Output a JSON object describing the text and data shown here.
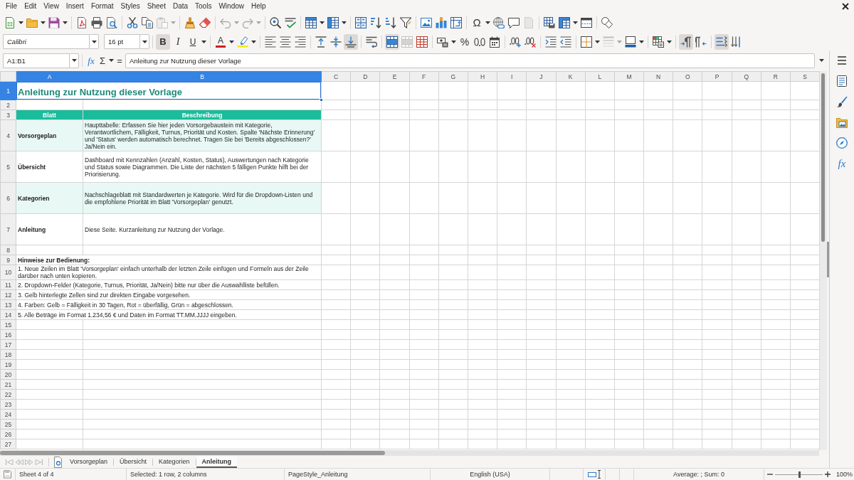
{
  "menu": [
    "File",
    "Edit",
    "View",
    "Insert",
    "Format",
    "Styles",
    "Sheet",
    "Data",
    "Tools",
    "Window",
    "Help"
  ],
  "standard_toolbar": [
    [
      {
        "kind": "new",
        "disabled": false
      },
      {
        "kind": "open",
        "disabled": false
      },
      {
        "kind": "save",
        "disabled": false
      }
    ],
    [
      {
        "kind": "pdf",
        "disabled": false
      },
      {
        "kind": "print",
        "disabled": false
      },
      {
        "kind": "preview",
        "disabled": false
      }
    ],
    [
      {
        "kind": "cut",
        "disabled": false
      },
      {
        "kind": "copy",
        "disabled": false
      },
      {
        "kind": "paste",
        "disabled": true
      }
    ],
    [
      {
        "kind": "clone",
        "disabled": false
      },
      {
        "kind": "clear",
        "disabled": false
      }
    ],
    [
      {
        "kind": "undo",
        "disabled": true
      },
      {
        "kind": "redo",
        "disabled": true
      }
    ],
    [
      {
        "kind": "find",
        "disabled": false
      },
      {
        "kind": "spelling",
        "disabled": false
      }
    ],
    [
      {
        "kind": "rows",
        "disabled": false
      },
      {
        "kind": "columns",
        "disabled": false
      }
    ],
    [
      {
        "kind": "sort",
        "disabled": false
      },
      {
        "kind": "ascending",
        "disabled": false
      },
      {
        "kind": "descending",
        "disabled": false
      },
      {
        "kind": "autofilter",
        "disabled": false
      }
    ],
    [
      {
        "kind": "image",
        "disabled": false
      },
      {
        "kind": "chart",
        "disabled": false
      },
      {
        "kind": "pivot",
        "disabled": false
      }
    ],
    [
      {
        "kind": "special",
        "label": "Ω",
        "disabled": false
      },
      {
        "kind": "hyperlink",
        "disabled": false
      },
      {
        "kind": "comment",
        "disabled": false
      },
      {
        "kind": "headers",
        "disabled": true
      }
    ],
    [
      {
        "kind": "printarea",
        "disabled": false
      },
      {
        "kind": "freeze",
        "disabled": false
      },
      {
        "kind": "split",
        "disabled": false
      }
    ],
    [
      {
        "kind": "shapes",
        "disabled": false
      }
    ]
  ],
  "formatting_toolbar": {
    "font_name": "Calibri",
    "font_size": "16 pt",
    "groups": [
      [
        {
          "kind": "bold",
          "label": "B",
          "pressed": true,
          "disabled": false
        },
        {
          "kind": "italic",
          "label": "I",
          "pressed": false,
          "disabled": false
        },
        {
          "kind": "underline",
          "label": "U",
          "pressed": false,
          "disabled": false
        }
      ],
      [
        {
          "kind": "fontcolor",
          "label": "A",
          "pressed": false,
          "disabled": false
        },
        {
          "kind": "highlight",
          "pressed": false,
          "disabled": false
        }
      ],
      [
        {
          "kind": "left",
          "pressed": false,
          "disabled": false
        },
        {
          "kind": "center",
          "pressed": false,
          "disabled": false
        },
        {
          "kind": "right",
          "pressed": false,
          "disabled": false
        }
      ],
      [
        {
          "kind": "top",
          "pressed": false,
          "disabled": false
        },
        {
          "kind": "middle",
          "pressed": false,
          "disabled": false
        },
        {
          "kind": "bottom",
          "pressed": true,
          "disabled": false
        }
      ],
      [
        {
          "kind": "wrap",
          "pressed": false,
          "disabled": false
        }
      ],
      [
        {
          "kind": "mergecenter",
          "pressed": true,
          "disabled": false
        },
        {
          "kind": "merge",
          "pressed": false,
          "disabled": true
        },
        {
          "kind": "unmerge",
          "pressed": false,
          "disabled": false
        }
      ],
      [
        {
          "kind": "currency",
          "pressed": false,
          "disabled": false
        },
        {
          "kind": "percent",
          "label": "%",
          "pressed": false,
          "disabled": false
        },
        {
          "kind": "standard",
          "pressed": false,
          "disabled": false
        },
        {
          "kind": "date",
          "pressed": false,
          "disabled": false
        }
      ],
      [
        {
          "kind": "adddecimal",
          "pressed": false,
          "disabled": false
        },
        {
          "kind": "deldecimal",
          "pressed": false,
          "disabled": false
        }
      ],
      [
        {
          "kind": "indent",
          "pressed": false,
          "disabled": false
        },
        {
          "kind": "outdent",
          "pressed": false,
          "disabled": false
        }
      ],
      [
        {
          "kind": "borders",
          "pressed": false,
          "disabled": false
        },
        {
          "kind": "borderstyle",
          "pressed": false,
          "disabled": true
        },
        {
          "kind": "bordercolor",
          "pressed": false,
          "disabled": false
        }
      ],
      [
        {
          "kind": "conditional",
          "pressed": false,
          "disabled": false
        }
      ],
      [
        {
          "kind": "ltr",
          "pressed": true,
          "disabled": false
        },
        {
          "kind": "rtl",
          "pressed": false,
          "disabled": false
        }
      ],
      [
        {
          "kind": "textltr",
          "pressed": true,
          "disabled": false
        },
        {
          "kind": "texttb",
          "pressed": false,
          "disabled": false
        }
      ]
    ]
  },
  "formula_bar": {
    "name_box": "A1:B1",
    "wizard": "fx",
    "sum": "Σ",
    "equals": "=",
    "content": "Anleitung zur Nutzung dieser Vorlage"
  },
  "sheet": {
    "columns": [
      {
        "label": "A",
        "selected": true
      },
      {
        "label": "B",
        "selected": true
      },
      {
        "label": "C",
        "selected": false
      },
      {
        "label": "D",
        "selected": false
      },
      {
        "label": "E",
        "selected": false
      },
      {
        "label": "F",
        "selected": false
      },
      {
        "label": "G",
        "selected": false
      },
      {
        "label": "H",
        "selected": false
      },
      {
        "label": "I",
        "selected": false
      },
      {
        "label": "J",
        "selected": false
      },
      {
        "label": "K",
        "selected": false
      },
      {
        "label": "L",
        "selected": false
      },
      {
        "label": "M",
        "selected": false
      },
      {
        "label": "N",
        "selected": false
      },
      {
        "label": "O",
        "selected": false
      },
      {
        "label": "P",
        "selected": false
      },
      {
        "label": "Q",
        "selected": false
      },
      {
        "label": "R",
        "selected": false
      },
      {
        "label": "S",
        "selected": false
      }
    ],
    "rows": [
      {
        "label": "1",
        "selected": true,
        "kind": "title",
        "cells": [
          "Anleitung zur Nutzung dieser Vorlage"
        ]
      },
      {
        "label": "2",
        "selected": false,
        "kind": "blank"
      },
      {
        "label": "3",
        "selected": false,
        "kind": "header",
        "cells": [
          "Blatt",
          "Beschreibung"
        ]
      },
      {
        "label": "4",
        "selected": false,
        "kind": "entry",
        "shaded": true,
        "cells": [
          "Vorsorgeplan",
          "Haupttabelle: Erfassen Sie hier jeden Vorsorgebaustein mit Kategorie, Verantwortlichem, Fälligkeit, Turnus, Priorität und Kosten. Spalte 'Nächste Erinnerung' und 'Status' werden automatisch berechnet. Tragen Sie bei 'Bereits abgeschlossen?' Ja/Nein ein."
        ]
      },
      {
        "label": "5",
        "selected": false,
        "kind": "entry",
        "shaded": false,
        "cells": [
          "Übersicht",
          "Dashboard mit Kennzahlen (Anzahl, Kosten, Status), Auswertungen nach Kategorie und Status sowie Diagrammen. Die Liste der nächsten 5 fälligen Punkte hilft bei der Priorisierung."
        ]
      },
      {
        "label": "6",
        "selected": false,
        "kind": "entry",
        "shaded": true,
        "cells": [
          "Kategorien",
          "Nachschlageblatt mit Standardwerten je Kategorie. Wird für die Dropdown-Listen und die empfohlene Priorität im Blatt 'Vorsorgeplan' genutzt."
        ]
      },
      {
        "label": "7",
        "selected": false,
        "kind": "entry",
        "shaded": false,
        "cells": [
          "Anleitung",
          "Diese Seite. Kurzanleitung zur Nutzung der Vorlage."
        ]
      },
      {
        "label": "8",
        "selected": false,
        "kind": "blank"
      },
      {
        "label": "9",
        "selected": false,
        "kind": "heading",
        "cells": [
          "Hinweise zur Bedienung:"
        ]
      },
      {
        "label": "10",
        "selected": false,
        "kind": "note",
        "cells": [
          "1. Neue Zeilen im Blatt 'Vorsorgeplan' einfach unterhalb der letzten Zeile einfügen und Formeln aus der Zeile darüber nach unten kopieren."
        ]
      },
      {
        "label": "11",
        "selected": false,
        "kind": "note",
        "cells": [
          "2. Dropdown-Felder (Kategorie, Turnus, Priorität, Ja/Nein) bitte nur über die Auswahlliste befüllen."
        ]
      },
      {
        "label": "12",
        "selected": false,
        "kind": "note",
        "cells": [
          "3. Gelb hinterlegte Zellen sind zur direkten Eingabe vorgesehen."
        ]
      },
      {
        "label": "13",
        "selected": false,
        "kind": "note",
        "cells": [
          "4. Farben: Gelb = Fälligkeit in 30 Tagen, Rot = überfällig, Grün = abgeschlossen."
        ]
      },
      {
        "label": "14",
        "selected": false,
        "kind": "note",
        "cells": [
          "5. Alle Beträge im Format 1.234,56 € und Daten im Format TT.MM.JJJJ eingeben."
        ]
      },
      {
        "label": "15",
        "selected": false,
        "kind": "blank"
      },
      {
        "label": "16",
        "selected": false,
        "kind": "blank"
      },
      {
        "label": "17",
        "selected": false,
        "kind": "blank"
      },
      {
        "label": "18",
        "selected": false,
        "kind": "blank"
      },
      {
        "label": "19",
        "selected": false,
        "kind": "blank"
      },
      {
        "label": "20",
        "selected": false,
        "kind": "blank"
      },
      {
        "label": "21",
        "selected": false,
        "kind": "blank"
      },
      {
        "label": "22",
        "selected": false,
        "kind": "blank"
      },
      {
        "label": "23",
        "selected": false,
        "kind": "blank"
      },
      {
        "label": "24",
        "selected": false,
        "kind": "blank"
      },
      {
        "label": "25",
        "selected": false,
        "kind": "blank"
      },
      {
        "label": "26",
        "selected": false,
        "kind": "blank"
      },
      {
        "label": "27",
        "selected": false,
        "kind": "blank"
      }
    ]
  },
  "sidebar": [
    {
      "kind": "properties"
    },
    {
      "kind": "styles"
    },
    {
      "kind": "gallery"
    },
    {
      "kind": "navigator"
    },
    {
      "kind": "functions",
      "label": "fx"
    }
  ],
  "sheet_tabs": {
    "navigation": {
      "disabled": true
    },
    "tabs": [
      {
        "label": "Vorsorgeplan",
        "selected": false
      },
      {
        "label": "Übersicht",
        "selected": false
      },
      {
        "label": "Kategorien",
        "selected": false
      },
      {
        "label": "Anleitung",
        "selected": true
      }
    ]
  },
  "status_bar": {
    "sheet": "Sheet 4 of 4",
    "selection": "Selected: 1 row, 2 columns",
    "page_style": "PageStyle_Anleitung",
    "language": "English (USA)",
    "summary": "Average: ; Sum: 0",
    "zoom_slider": {
      "level": 0.5
    },
    "zoom": "100%"
  }
}
